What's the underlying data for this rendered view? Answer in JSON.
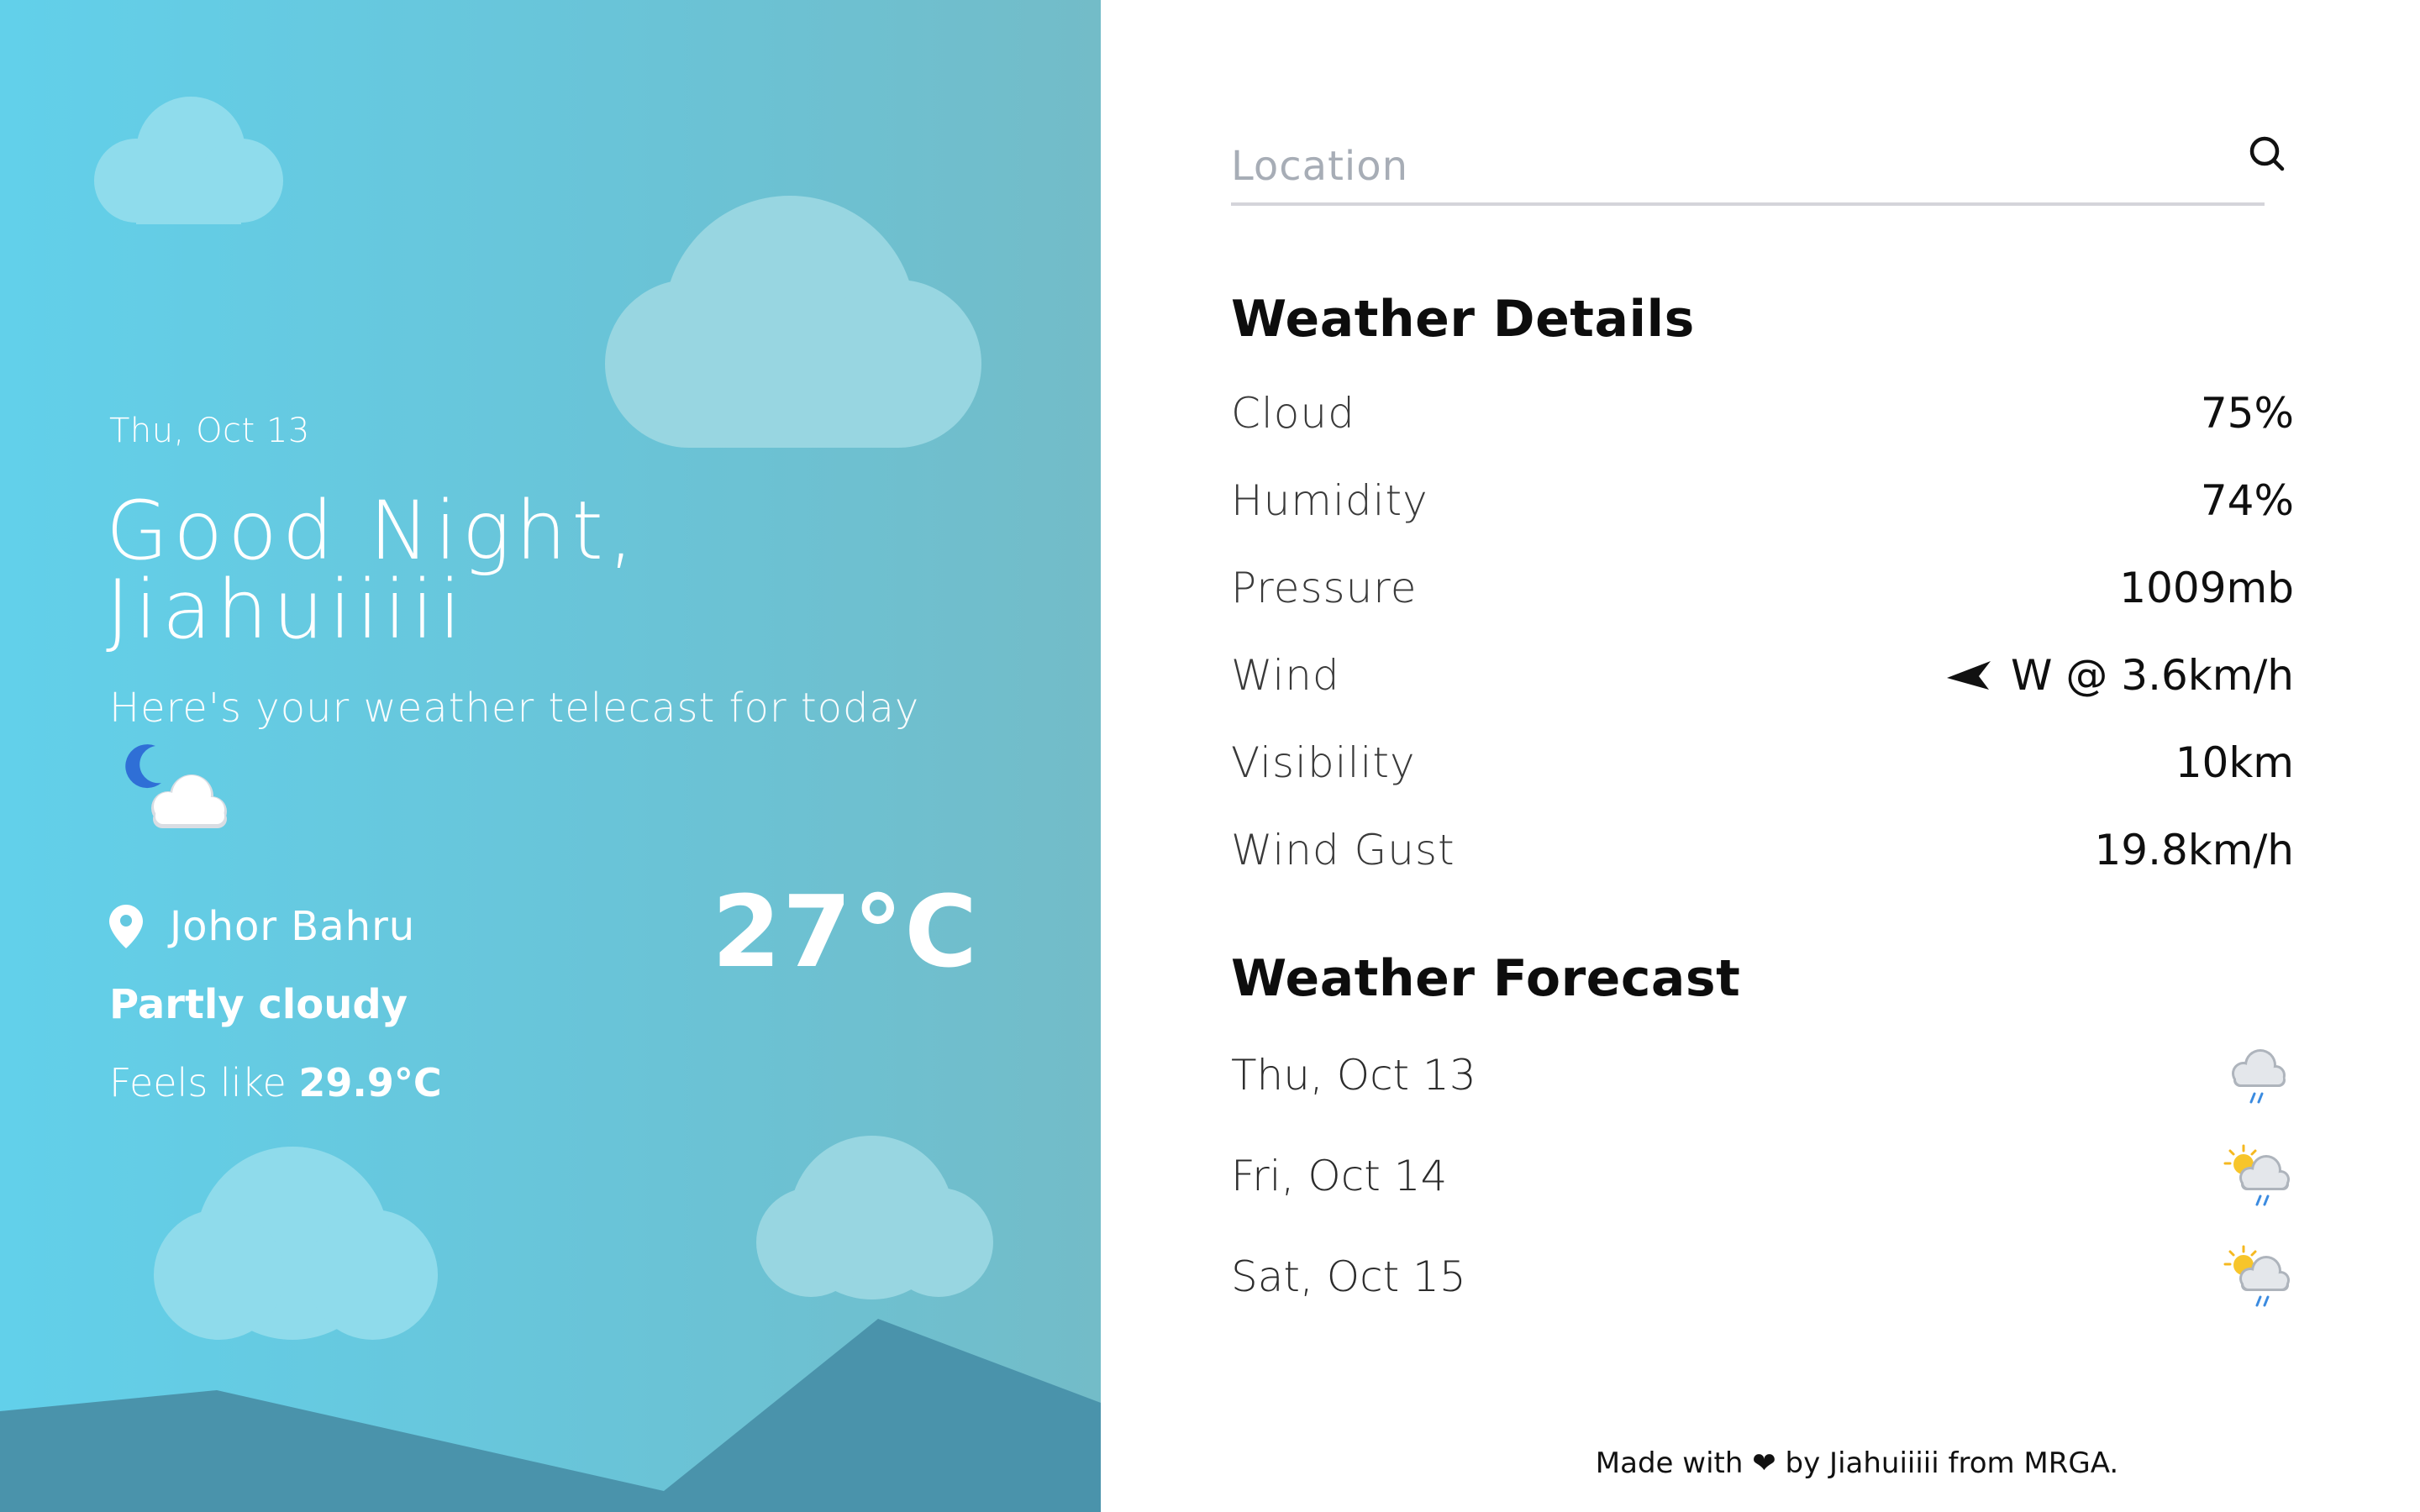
{
  "left": {
    "date": "Thu, Oct 13",
    "greeting_line1": "Good Night,",
    "greeting_line2": "Jiahuiiiii",
    "subtitle": "Here's your weather telecast for today",
    "condition_icon": "moon-cloud-icon",
    "location": "Johor Bahru",
    "condition": "Partly cloudy",
    "feels_prefix": "Feels like",
    "feels_value": "29.9°C",
    "temperature": "27°C"
  },
  "search": {
    "placeholder": "Location",
    "icon": "search-icon"
  },
  "details": {
    "title": "Weather Details",
    "rows": [
      {
        "label": "Cloud",
        "value": "75%"
      },
      {
        "label": "Humidity",
        "value": "74%"
      },
      {
        "label": "Pressure",
        "value": "1009mb"
      },
      {
        "label": "Wind",
        "value": "W @ 3.6km/h"
      },
      {
        "label": "Visibility",
        "value": "10km"
      },
      {
        "label": "Wind Gust",
        "value": "19.8km/h"
      }
    ]
  },
  "forecast": {
    "title": "Weather Forecast",
    "days": [
      {
        "date": "Thu, Oct 13",
        "icon": "rain-cloud-icon"
      },
      {
        "date": "Fri, Oct 14",
        "icon": "sun-rain-cloud-icon"
      },
      {
        "date": "Sat, Oct 15",
        "icon": "sun-rain-cloud-icon"
      }
    ]
  },
  "footer": {
    "prefix": "Made with",
    "heart": "❤",
    "suffix": "by Jiahuiiiii from MRGA."
  },
  "colors": {
    "gradient_start": "#62d0ea",
    "gradient_end": "#73bcc8",
    "cloud": "#a8e0ec",
    "mountain": "#4a8fa6"
  }
}
